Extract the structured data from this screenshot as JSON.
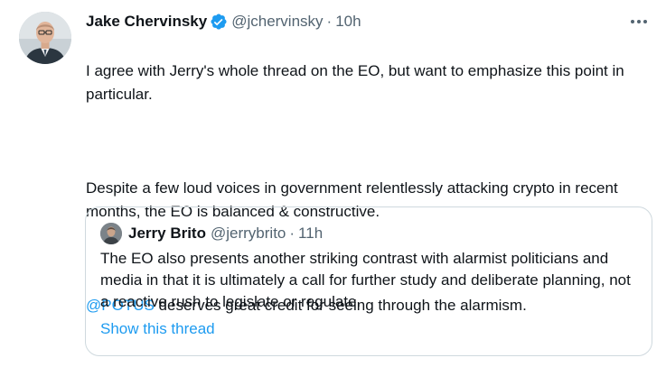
{
  "tweet": {
    "author": {
      "name": "Jake Chervinsky",
      "handle": "@jchervinsky",
      "avatar_icon": "profile-photo",
      "verified_icon": "verified-badge-icon",
      "verified_color": "#1d9bf0"
    },
    "separator": "·",
    "time": "10h",
    "more_icon": "more-options-icon",
    "paragraphs": [
      "I agree with Jerry's whole thread on the EO, but want to emphasize this point in particular.",
      "Despite a few loud voices in government relentlessly attacking crypto in recent months, the EO is balanced & constructive."
    ],
    "mention_line": {
      "mention": "@POTUS",
      "text": " deserves great credit for seeing through the alarmism."
    }
  },
  "quoted": {
    "author": {
      "name": "Jerry Brito",
      "handle": "@jerrybrito",
      "avatar_icon": "profile-photo"
    },
    "separator": "·",
    "time": "11h",
    "text": "The EO also presents another striking contrast with alarmist politicians and media in that it is ultimately a call for further study and deliberate planning, not a reactive rush to legislate or regulate.",
    "show_thread": "Show this thread"
  },
  "colors": {
    "link": "#1d9bf0",
    "secondary_text": "#536471",
    "border": "#cfd9de"
  }
}
